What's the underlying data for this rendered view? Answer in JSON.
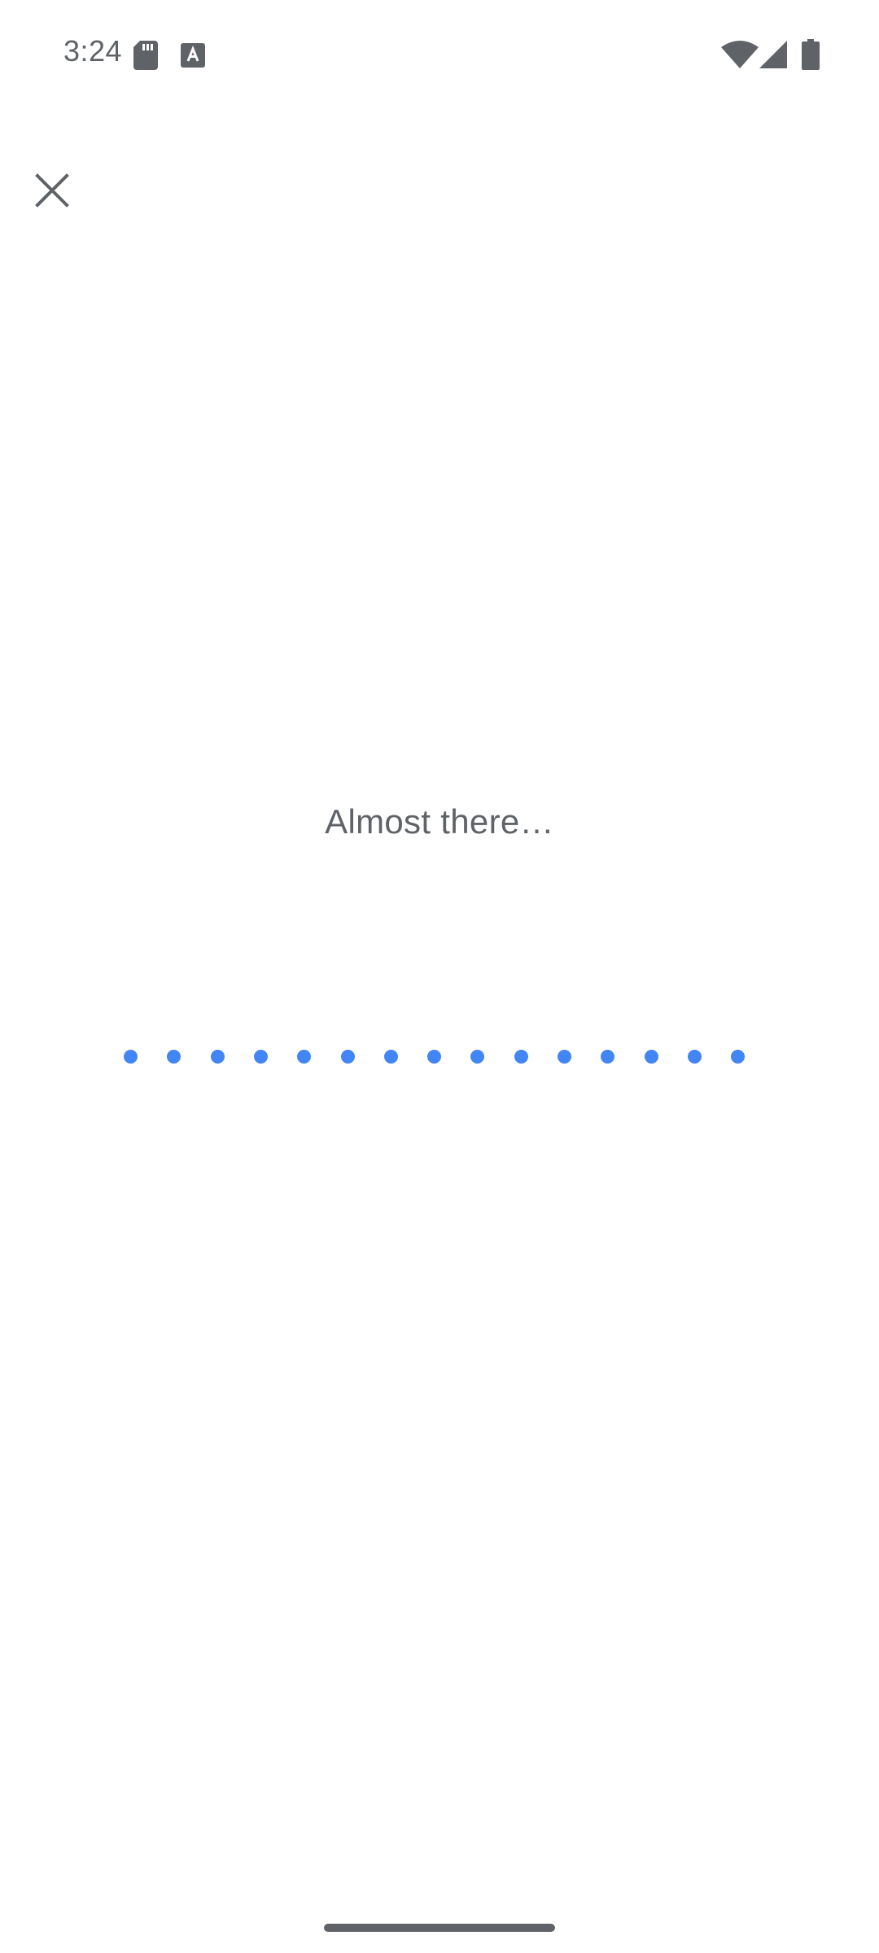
{
  "status_bar": {
    "time": "3:24",
    "icons": [
      "sd-card-icon",
      "a-notification-icon",
      "wifi-icon",
      "cell-signal-icon",
      "battery-icon"
    ]
  },
  "toolbar": {
    "close_icon": "close-icon"
  },
  "loading": {
    "message": "Almost there…",
    "dot_count": 15,
    "dot_color": "#4285f4"
  },
  "colors": {
    "background": "#ffffff",
    "text_secondary": "#5f6368",
    "accent": "#4285f4"
  }
}
